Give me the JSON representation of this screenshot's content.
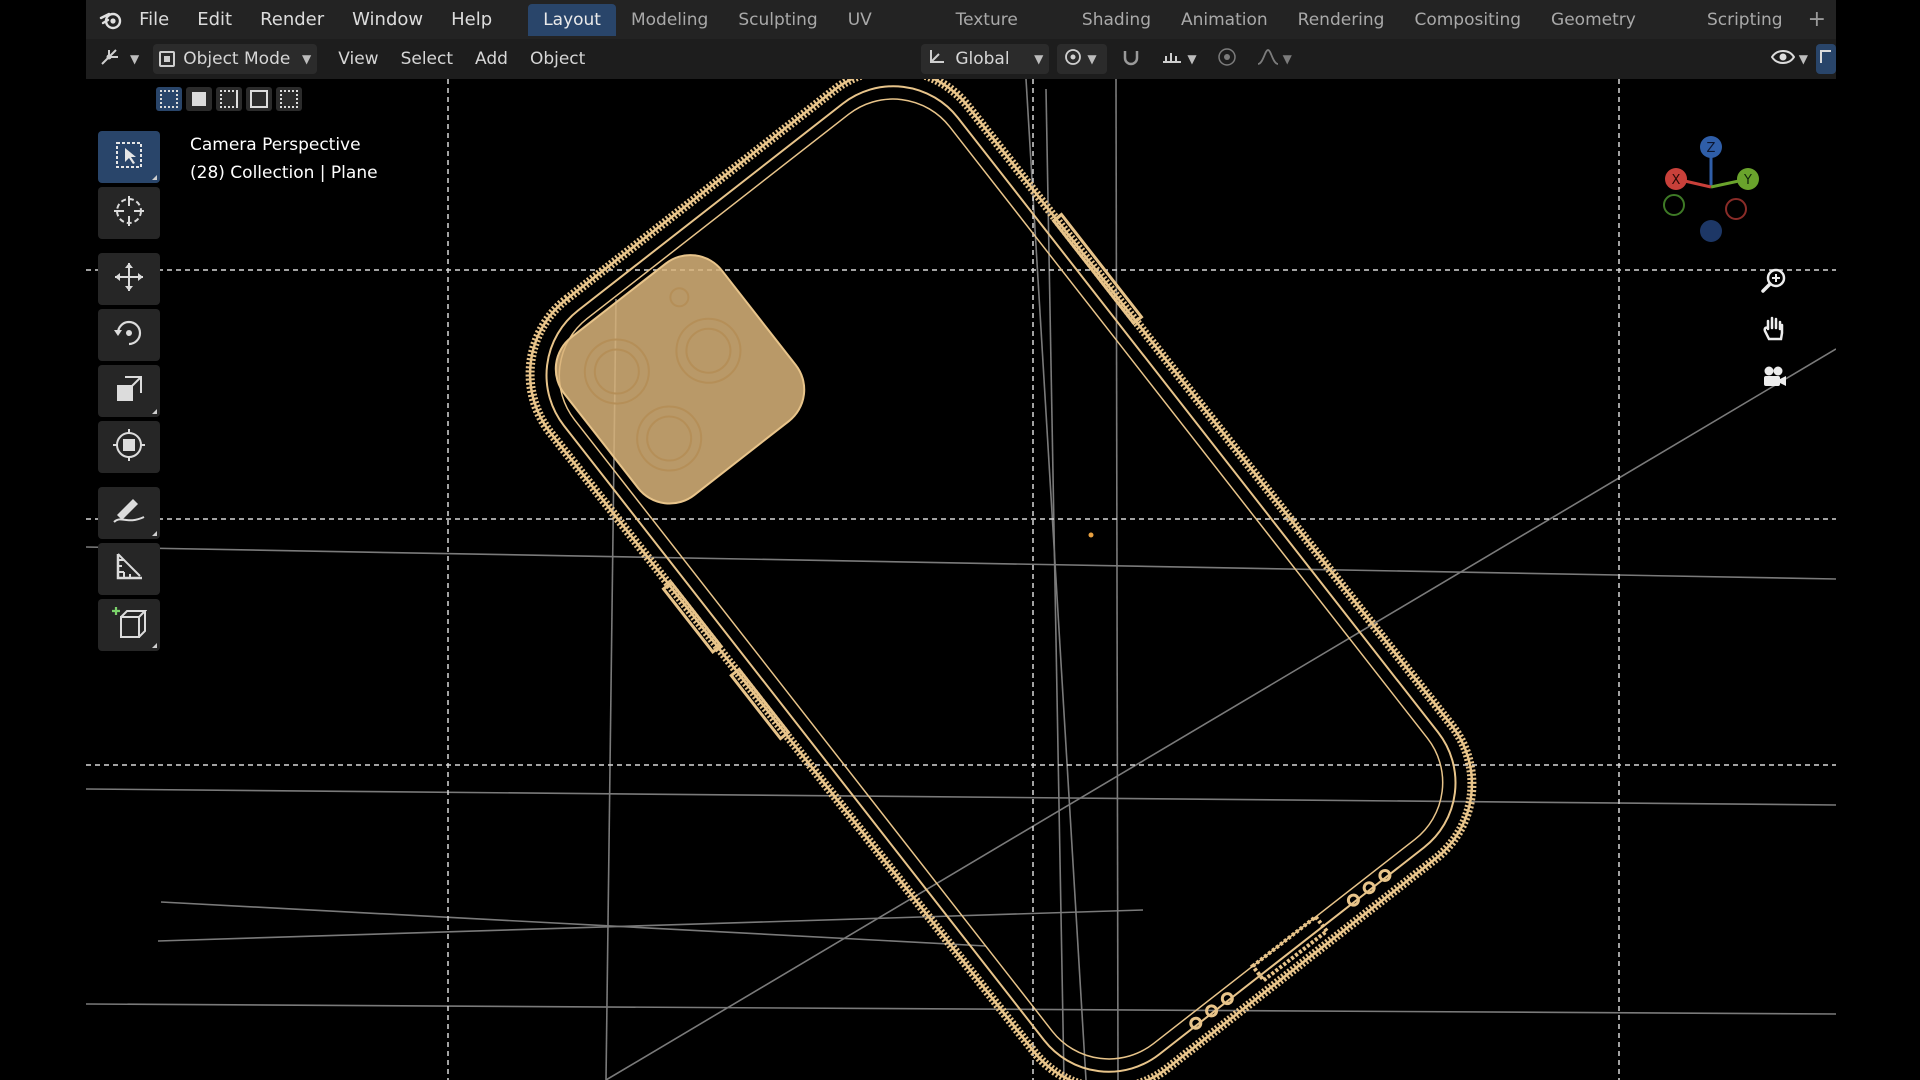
{
  "menubar": {
    "items": [
      "File",
      "Edit",
      "Render",
      "Window",
      "Help"
    ]
  },
  "workspaces": {
    "tabs": [
      "Layout",
      "Modeling",
      "Sculpting",
      "UV Editing",
      "Texture Paint",
      "Shading",
      "Animation",
      "Rendering",
      "Compositing",
      "Geometry Nodes",
      "Scripting"
    ],
    "active": "Layout",
    "add_label": "+"
  },
  "header": {
    "mode": "Object Mode",
    "menus": [
      "View",
      "Select",
      "Add",
      "Object"
    ],
    "transform_orientation": "Global"
  },
  "viewport": {
    "view_name": "Camera Perspective",
    "collection_info": "(28) Collection | Plane",
    "wire_color": "#e8c48a",
    "gizmo_axes": {
      "z": "Z",
      "y": "Y",
      "x": "X"
    }
  },
  "toolbar": {
    "tools": [
      "select-box",
      "cursor",
      "move",
      "rotate",
      "scale",
      "transform",
      "annotate",
      "measure",
      "add-cube"
    ]
  },
  "colors": {
    "accent": "#29456a",
    "axis_x": "#c8403a",
    "axis_y": "#6aa32c",
    "axis_z": "#2f5ea8"
  }
}
